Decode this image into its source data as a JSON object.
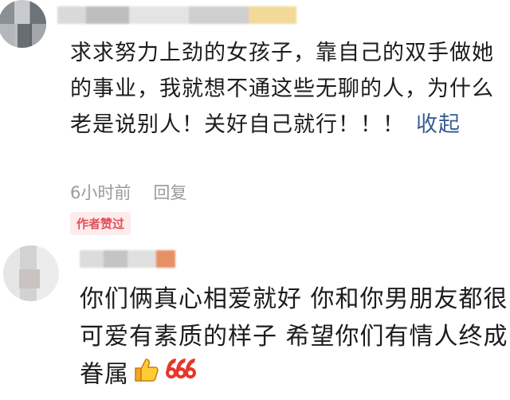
{
  "comment1": {
    "text": "求求努力上劲的女孩子，靠自己的双手做她的事业，我就想不通这些无聊的人，为什么老是说别人！关好自己就行！！！",
    "collapse_label": "收起",
    "time": "6小时前",
    "reply_label": "回复",
    "author_like_badge": "作者赞过"
  },
  "comment2": {
    "text": "你们俩真心相爱就好 你和你男朋友都很可爱有素质的样子 希望你们有情人终成眷属",
    "emojis": [
      "thumbs-up-icon",
      "666-icon"
    ]
  },
  "colors": {
    "link": "#3a5d94",
    "meta": "#9a9a9a",
    "badge_text": "#e24d5a",
    "badge_bg": "#fdeceb"
  }
}
